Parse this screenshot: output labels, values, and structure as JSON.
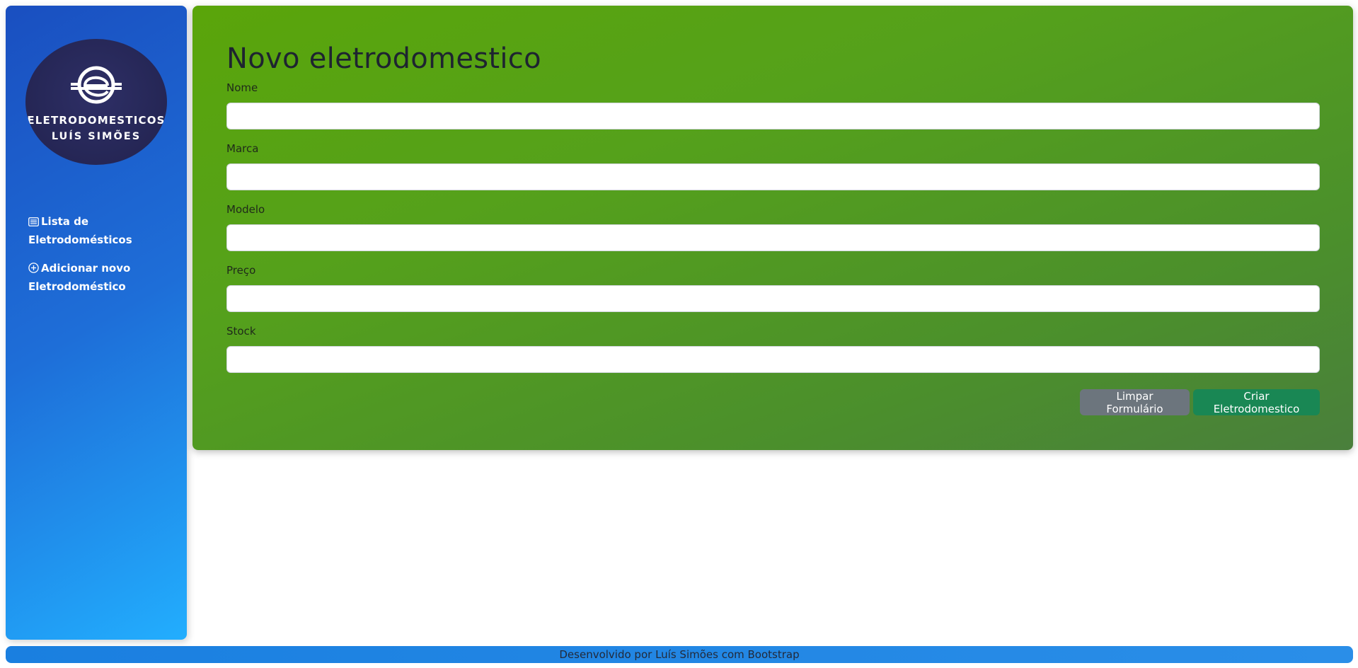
{
  "brand": {
    "line1": "ELETRODOMESTICOS",
    "line2": "LUÍS SIMÕES",
    "logo_icon": "e-circle-logo-icon"
  },
  "sidebar": {
    "items": [
      {
        "icon": "list-icon",
        "label": "Lista de Eletrodomésticos"
      },
      {
        "icon": "plus-circle-icon",
        "label": "Adicionar novo Eletrodoméstico"
      }
    ]
  },
  "form": {
    "title": "Novo eletrodomestico",
    "fields": [
      {
        "label": "Nome",
        "value": "",
        "placeholder": ""
      },
      {
        "label": "Marca",
        "value": "",
        "placeholder": ""
      },
      {
        "label": "Modelo",
        "value": "",
        "placeholder": ""
      },
      {
        "label": "Preço",
        "value": "",
        "placeholder": ""
      },
      {
        "label": "Stock",
        "value": "",
        "placeholder": ""
      }
    ],
    "clear_label": "Limpar Formulário",
    "submit_label": "Criar Eletrodomestico"
  },
  "footer": {
    "text": "Desenvolvido por Luís Simões com Bootstrap"
  },
  "colors": {
    "sidebar_gradient": [
      "#1a4fc0",
      "#22aefe"
    ],
    "card_gradient": [
      "#5aa50a",
      "#4a7f3c"
    ],
    "clear_button": "#6c757d",
    "submit_button": "#198754",
    "logo_bg": "#252655"
  }
}
